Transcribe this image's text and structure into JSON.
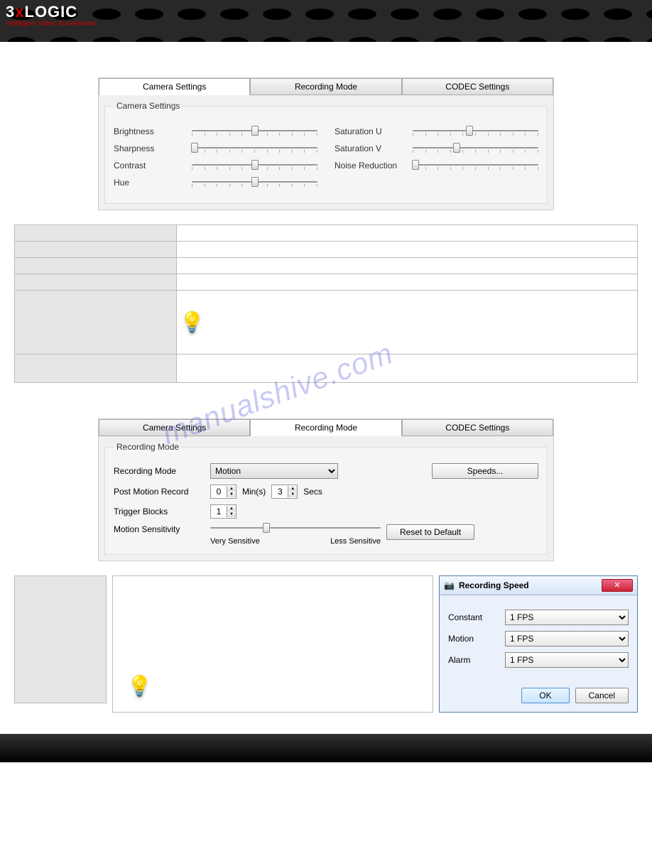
{
  "brand": {
    "part1": "3",
    "x": "x",
    "part2": "LOGIC",
    "tagline": "Intelligent Video Surveillance"
  },
  "watermark": "manualshive.com",
  "panel1": {
    "tabs": [
      "Camera Settings",
      "Recording Mode",
      "CODEC Settings"
    ],
    "legend": "Camera Settings",
    "left": [
      {
        "label": "Brightness",
        "pos": 50
      },
      {
        "label": "Sharpness",
        "pos": 2
      },
      {
        "label": "Contrast",
        "pos": 50
      },
      {
        "label": "Hue",
        "pos": 50
      }
    ],
    "right": [
      {
        "label": "Saturation U",
        "pos": 45
      },
      {
        "label": "Saturation V",
        "pos": 35
      },
      {
        "label": "Noise Reduction",
        "pos": 2
      }
    ]
  },
  "panel2": {
    "tabs": [
      "Camera Settings",
      "Recording Mode",
      "CODEC Settings"
    ],
    "legend": "Recording Mode",
    "mode_label": "Recording Mode",
    "mode_value": "Motion",
    "speeds_btn": "Speeds...",
    "pmr_label": "Post Motion Record",
    "pmr_min": "0",
    "pmr_min_unit": "Min(s)",
    "pmr_sec": "3",
    "pmr_sec_unit": "Secs",
    "tb_label": "Trigger Blocks",
    "tb_val": "1",
    "ms_label": "Motion Sensitivity",
    "ms_left": "Very Sensitive",
    "ms_right": "Less Sensitive",
    "reset_btn": "Reset to Default"
  },
  "dialog": {
    "title": "Recording Speed",
    "rows": [
      {
        "label": "Constant",
        "value": "1 FPS"
      },
      {
        "label": "Motion",
        "value": "1 FPS"
      },
      {
        "label": "Alarm",
        "value": "1 FPS"
      }
    ],
    "ok": "OK",
    "cancel": "Cancel"
  }
}
